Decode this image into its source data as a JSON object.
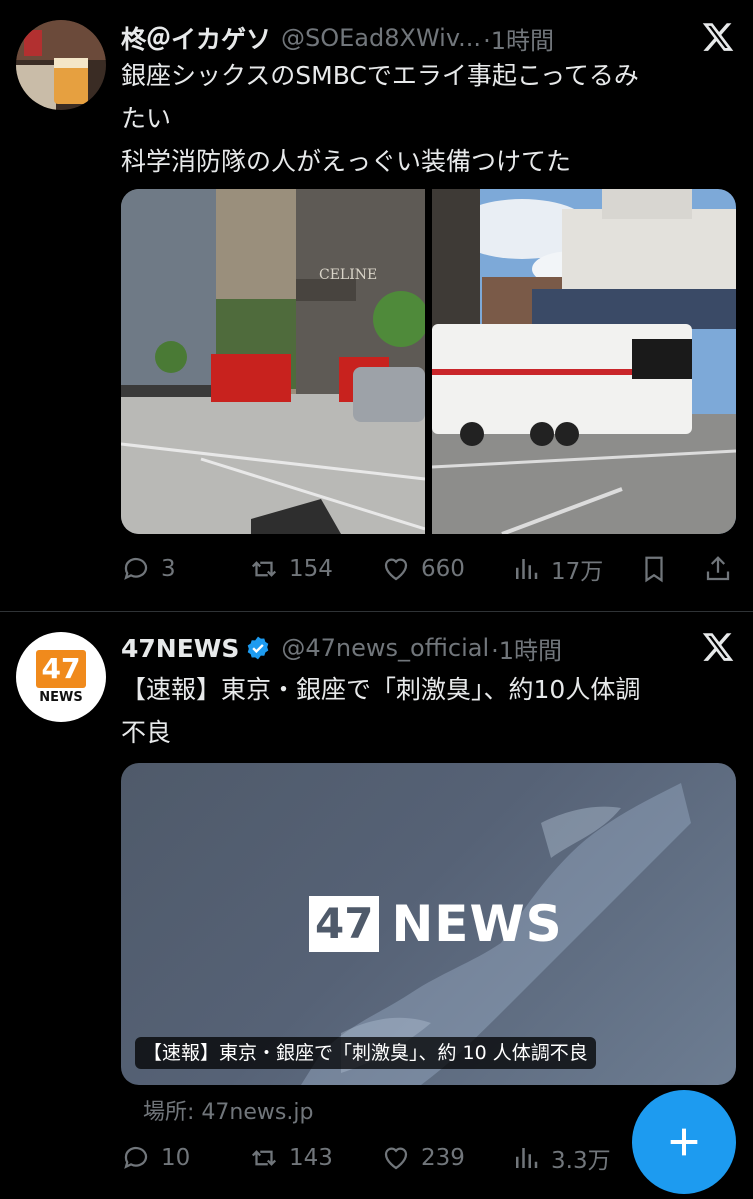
{
  "tweets": [
    {
      "name": "柊＠イカゲソ",
      "handle": "@SOEad8XWiv...",
      "time": "·1時間",
      "text_lines": [
        "銀座シックスのSMBCでエライ事起こってるみ",
        "たい",
        "科学消防隊の人がえっぐい装備つけてた"
      ],
      "stats": {
        "replies": "3",
        "retweets": "154",
        "likes": "660",
        "views": "17万"
      }
    },
    {
      "name": "47NEWS",
      "handle": "@47news_official",
      "time": "·1時間",
      "text_lines": [
        "【速報】東京・銀座で「刺激臭」、約10人体調",
        "不良"
      ],
      "card": {
        "logo_num": "47",
        "logo_word": "NEWS",
        "caption": "【速報】東京・銀座で「刺激臭」、約 10 人体調不良",
        "source": "場所: 47news.jp"
      },
      "stats": {
        "replies": "10",
        "retweets": "143",
        "likes": "239",
        "views": "3.3万"
      }
    }
  ],
  "avatar_47": {
    "num": "47",
    "word": "NEWS"
  },
  "colors": {
    "accent": "#1d9bf0",
    "muted": "#71767b",
    "text": "#e7e9ea",
    "bg": "#000000"
  }
}
